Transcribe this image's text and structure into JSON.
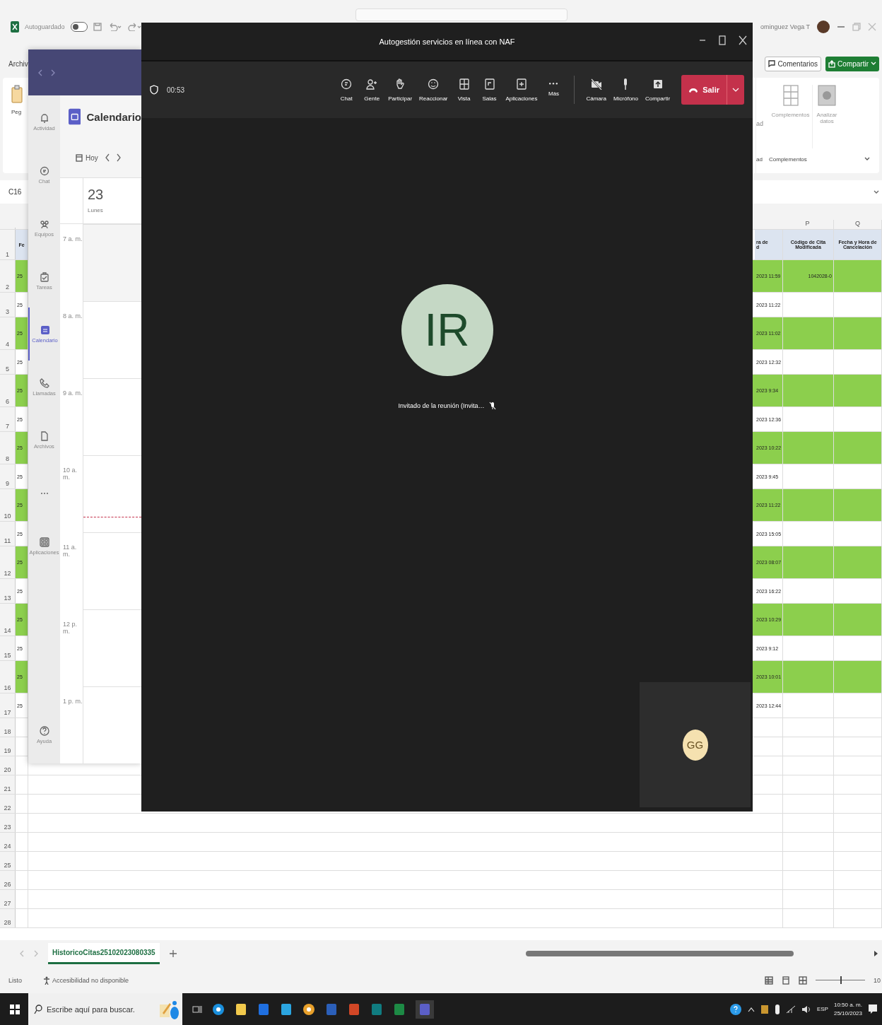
{
  "excel": {
    "autosave_label": "Autoguardado",
    "autosave_on": false,
    "user_name": "ominguez Vega T",
    "menu_first": "Archiv",
    "comments_button": "Comentarios",
    "share_button": "Compartir",
    "ribbon": {
      "paste_label": "Peg",
      "cut_button": "ad",
      "cut_group": "ad",
      "addins_label": "Complementos",
      "analyze_label": "Analizar datos",
      "group_label": "Complementos"
    },
    "name_box": "C16",
    "columns": [
      {
        "letter": "P"
      },
      {
        "letter": "Q"
      }
    ],
    "header": {
      "number": "1",
      "col_a": "Fe",
      "col_o": "ra de\nd",
      "col_p": "Código de Cita Modificada",
      "col_q": "Fecha y Hora de Cancelación"
    },
    "rows": [
      {
        "number": "2",
        "col_a": "25",
        "col_o": "2023 11:59",
        "col_p": "1042028-0",
        "highlighted": true
      },
      {
        "number": "3",
        "col_a": "25",
        "col_o": "2023 11:22",
        "highlighted": false
      },
      {
        "number": "4",
        "col_a": "25",
        "col_o": "2023 11:02",
        "highlighted": true
      },
      {
        "number": "5",
        "col_a": "25",
        "col_o": "2023 12:32",
        "highlighted": false
      },
      {
        "number": "6",
        "col_a": "25",
        "col_o": "2023 9:34",
        "highlighted": true
      },
      {
        "number": "7",
        "col_a": "25",
        "col_o": "2023 12:36",
        "highlighted": false
      },
      {
        "number": "8",
        "col_a": "25",
        "col_o": "2023 10:22",
        "highlighted": true
      },
      {
        "number": "9",
        "col_a": "25",
        "col_o": "2023 9:45",
        "highlighted": false
      },
      {
        "number": "10",
        "col_a": "25",
        "col_o": "2023 11:22",
        "highlighted": true
      },
      {
        "number": "11",
        "col_a": "25",
        "col_o": "2023 15:05",
        "highlighted": false
      },
      {
        "number": "12",
        "col_a": "25",
        "col_o": "2023 08:07",
        "highlighted": true
      },
      {
        "number": "13",
        "col_a": "25",
        "col_o": "2023 16:22",
        "highlighted": false
      },
      {
        "number": "14",
        "col_a": "25",
        "col_o": "2023 10:29",
        "highlighted": true
      },
      {
        "number": "15",
        "col_a": "25",
        "col_o": "2023 9:12",
        "highlighted": false
      },
      {
        "number": "16",
        "col_a": "25",
        "col_o": "2023 10:01",
        "highlighted": true
      },
      {
        "number": "17",
        "col_a": "25",
        "col_o": "2023 12:44",
        "highlighted": false
      },
      {
        "number": "18"
      },
      {
        "number": "19"
      },
      {
        "number": "20"
      },
      {
        "number": "21"
      },
      {
        "number": "22"
      },
      {
        "number": "23"
      },
      {
        "number": "24"
      },
      {
        "number": "25"
      },
      {
        "number": "26"
      },
      {
        "number": "27"
      },
      {
        "number": "28"
      }
    ],
    "sheet_tabs": [
      {
        "label": "HistoricoCitas25102023080335",
        "selected": true
      }
    ],
    "status": "Listo",
    "accessibility": "Accesibilidad no disponible",
    "zoom": {
      "level": 0.5,
      "reading": "10"
    }
  },
  "calendar_window": {
    "rail": [
      {
        "label": "Actividad",
        "selected": false
      },
      {
        "label": "Chat",
        "selected": false
      },
      {
        "label": "Equipos",
        "selected": false
      },
      {
        "label": "Tareas",
        "selected": false
      },
      {
        "label": "Calendario",
        "selected": true
      },
      {
        "label": "Llamadas",
        "selected": false
      },
      {
        "label": "Archivos",
        "selected": false
      },
      {
        "selected": false
      },
      {
        "label": "Aplicaciones",
        "selected": false
      }
    ],
    "help": "Ayuda",
    "title": "Calendario",
    "today": "Hoy",
    "day_number": "23",
    "day_name": "Lunes",
    "hours": [
      "7 a. m.",
      "8 a. m.",
      "9 a. m.",
      "10 a. m.",
      "11 a. m.",
      "12 p. m.",
      "1 p. m."
    ]
  },
  "meeting": {
    "title": "Autogestión servicios en línea con NAF",
    "timer": "00:53",
    "tools": [
      {
        "label": "Chat"
      },
      {
        "label": "Gente"
      },
      {
        "label": "Participar"
      },
      {
        "label": "Reaccionar"
      },
      {
        "label": "Vista"
      },
      {
        "label": "Salas"
      },
      {
        "label": "Aplicaciones"
      },
      {
        "label": "Más"
      }
    ],
    "devices": [
      {
        "label": "Cámara",
        "on": false
      },
      {
        "label": "Micrófono",
        "on": true
      },
      {
        "label": "Compartir"
      }
    ],
    "leave": "Salir",
    "participant": {
      "initials": "IR",
      "name": "Invitado de la reunión (Invita…",
      "muted": true
    },
    "self": {
      "initials": "GG"
    }
  },
  "taskbar": {
    "search_placeholder": "Escribe aquí para buscar.",
    "language": "ESP",
    "time": "10:50 a. m.",
    "date": "25/10/2023"
  }
}
